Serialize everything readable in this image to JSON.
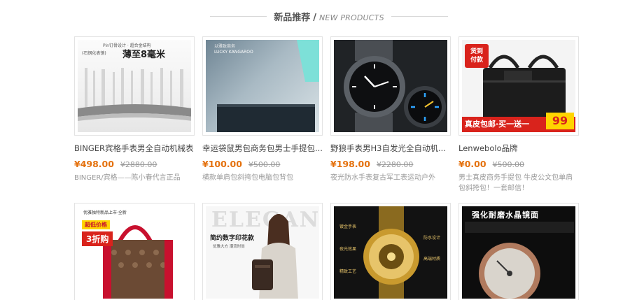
{
  "section": {
    "title_zh": "新品推荐",
    "separator": "/",
    "title_en": "NEW PRODUCTS"
  },
  "products": [
    {
      "name": "BINGER宾格手表男全自动机械表",
      "price": "¥498.00",
      "old_price": "¥2880.00",
      "desc": "BINGER/宾格——陈小春代言正品",
      "image_text": [
        "Pin钉骨设计 · 超合金结构",
        "(石钢化表镜)",
        "薄至8毫米"
      ]
    },
    {
      "name": "幸运袋鼠男包商务包男士手提包...",
      "price": "¥100.00",
      "old_price": "¥500.00",
      "desc": "横款单肩包斜挎包电脑包背包",
      "image_text": [
        "以雅致商务",
        "LUCKY KANGAROO"
      ]
    },
    {
      "name": "野狼手表男H3自发光全自动机...",
      "price": "¥198.00",
      "old_price": "¥2280.00",
      "desc": "夜光防水手表复古军工表运动户外",
      "image_text": []
    },
    {
      "name": "Lenwebolo品牌",
      "price": "¥0.00",
      "old_price": "¥500.00",
      "desc": "男士真皮商务手提包 牛皮公文包单肩包斜挎包！一套邮信！",
      "image_text": [
        "货到",
        "付款",
        "真皮包邮·买一送一",
        "99"
      ]
    },
    {
      "name": "",
      "price": "",
      "old_price": "",
      "desc": "",
      "image_text": [
        "优雅独特新品上市·全新",
        "超低价格",
        "3折购"
      ]
    },
    {
      "name": "",
      "price": "",
      "old_price": "",
      "desc": "",
      "image_text": [
        "ELEGANT",
        "简约数字印花款",
        "优雅大方 潮流时尚"
      ]
    },
    {
      "name": "",
      "price": "",
      "old_price": "",
      "desc": "",
      "image_text": [
        "镀金手表",
        "夜光效果",
        "高端材质",
        "精致工艺",
        "防水设计"
      ]
    },
    {
      "name": "",
      "price": "",
      "old_price": "",
      "desc": "",
      "image_text": [
        "强化耐磨水晶镜面"
      ]
    }
  ],
  "colors": {
    "price": "#e4710d",
    "accent_red": "#d9231c",
    "badge_yellow": "#ffd400"
  }
}
